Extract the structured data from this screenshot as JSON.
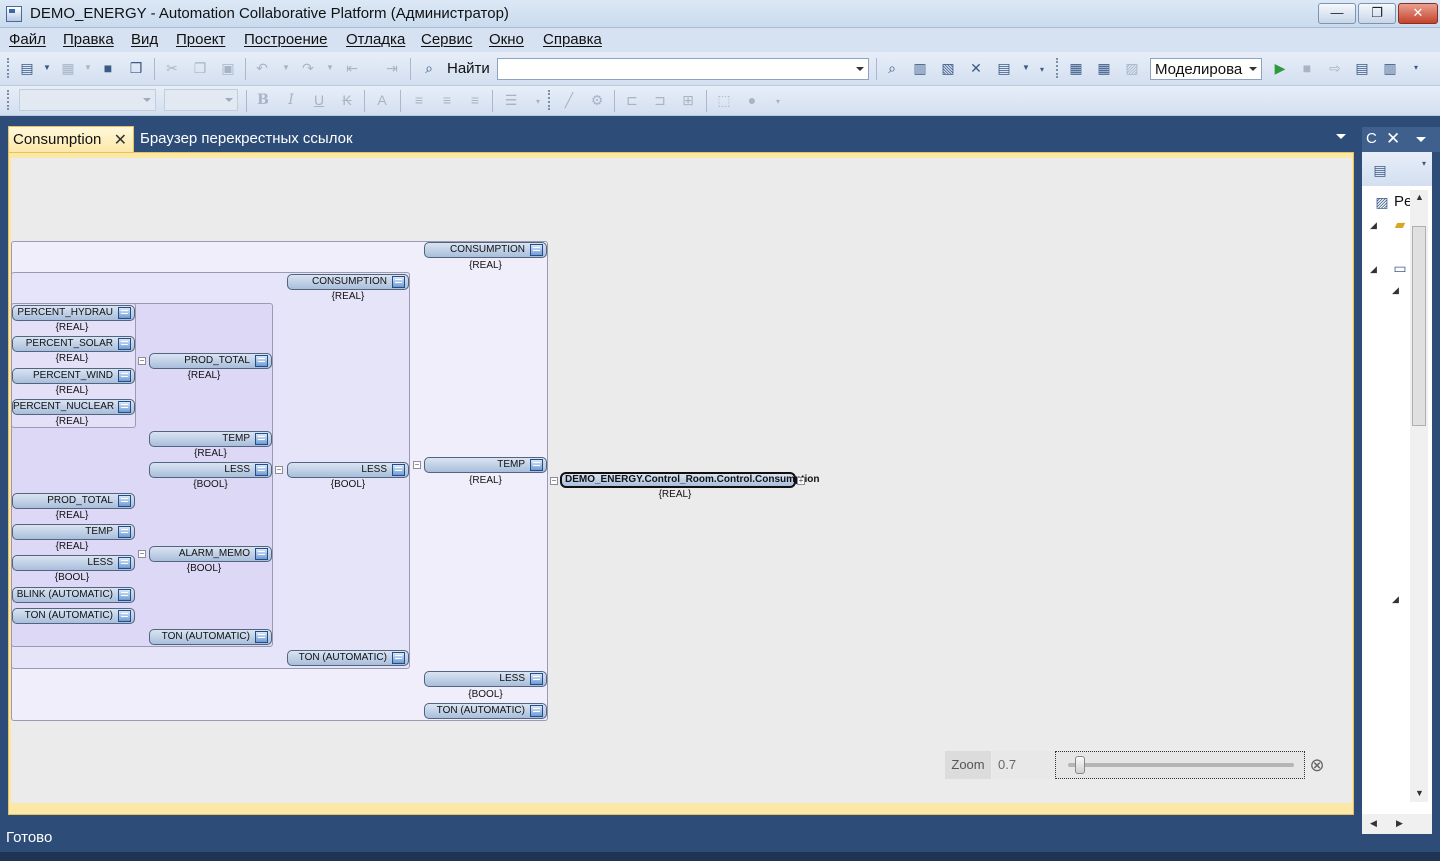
{
  "window": {
    "title": "DEMO_ENERGY - Automation Collaborative Platform (Администратор)",
    "min_label": "—",
    "max_label": "❐",
    "close_label": "✕"
  },
  "menu": [
    "Файл",
    "Правка",
    "Вид",
    "Проект",
    "Построение",
    "Отладка",
    "Сервис",
    "Окно",
    "Справка"
  ],
  "toolbar": {
    "find_label": "Найти",
    "find_value": "",
    "mode_value": "Моделирова"
  },
  "tabs": {
    "active": "Consumption",
    "active_close": "✕",
    "inactive": "Браузер перекрестных ссылок"
  },
  "diagram": {
    "nodes": {
      "consumption_top": "CONSUMPTION",
      "consumption_top_type": "{REAL}",
      "consumption_2": "CONSUMPTION",
      "consumption_2_type": "{REAL}",
      "percent_hydrau": "PERCENT_HYDRAU",
      "percent_hydrau_type": "{REAL}",
      "percent_solar": "PERCENT_SOLAR",
      "percent_solar_type": "{REAL}",
      "percent_wind": "PERCENT_WIND",
      "percent_wind_type": "{REAL}",
      "percent_nuclear": "PERCENT_NUCLEAR",
      "percent_nuclear_type": "{REAL}",
      "prod_total": "PROD_TOTAL",
      "prod_total_type": "{REAL}",
      "temp_a": "TEMP",
      "temp_a_type": "{REAL}",
      "less_a": "LESS",
      "less_a_type": "{BOOL}",
      "less_b": "LESS",
      "less_b_type": "{BOOL}",
      "prod_total_2": "PROD_TOTAL",
      "prod_total_2_type": "{REAL}",
      "temp_b": "TEMP",
      "temp_b_type": "{REAL}",
      "less_c": "LESS",
      "less_c_type": "{BOOL}",
      "blink": "BLINK (AUTOMATIC)",
      "ton_a": "TON (AUTOMATIC)",
      "alarm_memo": "ALARM_MEMO",
      "alarm_memo_type": "{BOOL}",
      "ton_b": "TON (AUTOMATIC)",
      "ton_c": "TON (AUTOMATIC)",
      "temp_c": "TEMP",
      "temp_c_type": "{REAL}",
      "less_d": "LESS",
      "less_d_type": "{BOOL}",
      "ton_d": "TON (AUTOMATIC)",
      "root": "DEMO_ENERGY.Control_Room.Control.Consumption",
      "root_type": "{REAL}"
    }
  },
  "zoom": {
    "label": "Zoom",
    "value": "0.7",
    "slider_fraction": 0.03
  },
  "side_panel": {
    "tab_label": "C",
    "close_label": "✕",
    "tree_item": "Pe"
  },
  "status": {
    "text": "Готово"
  },
  "colors": {
    "chrome": "#2d4d78",
    "active_tab": "#fce8a6",
    "canvas": "#ebebeb"
  }
}
